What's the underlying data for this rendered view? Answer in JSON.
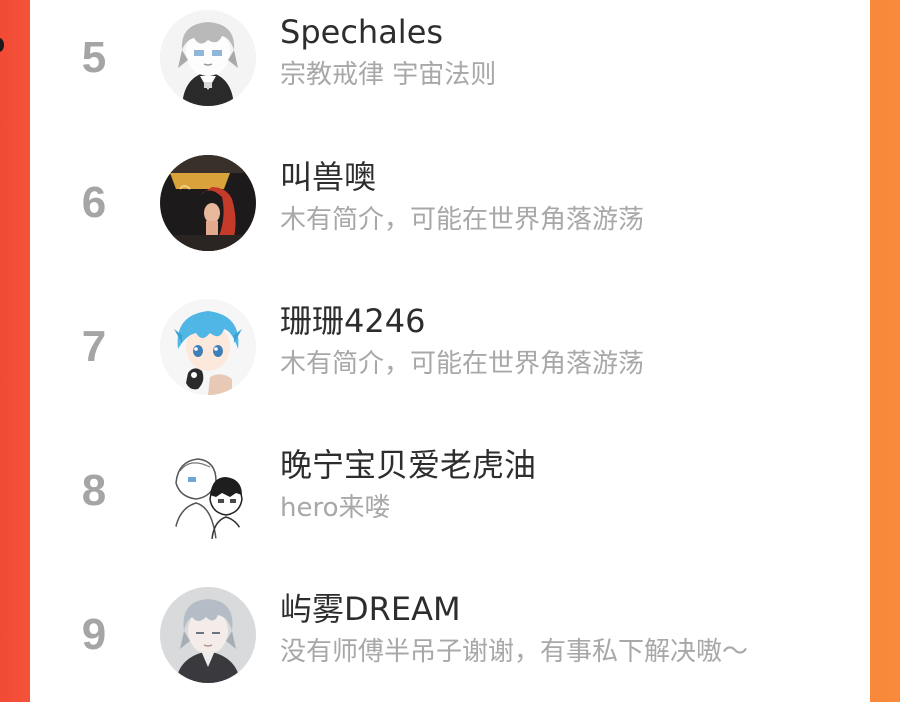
{
  "ranking": {
    "items": [
      {
        "rank": "5",
        "name": "Spechales",
        "bio": "宗教戒律 宇宙法则",
        "avatar_icon": "anime-gray-hair-avatar-icon"
      },
      {
        "rank": "6",
        "name": "叫兽噢",
        "bio": "木有简介，可能在世界角落游荡",
        "avatar_icon": "mermaid-poster-avatar-icon"
      },
      {
        "rank": "7",
        "name": "珊珊4246",
        "bio": "木有简介，可能在世界角落游荡",
        "avatar_icon": "anime-blue-hair-avatar-icon"
      },
      {
        "rank": "8",
        "name": "晚宁宝贝爱老虎油",
        "bio": "hero来喽",
        "avatar_icon": "sketch-couple-avatar-icon"
      },
      {
        "rank": "9",
        "name": "屿雾DREAM",
        "bio": "没有师傅半吊子谢谢，有事私下解决嗷～",
        "avatar_icon": "anime-silver-hair-avatar-icon"
      }
    ]
  },
  "colors": {
    "background_left": "#f24a35",
    "background_right": "#f88a3a",
    "panel": "#ffffff",
    "rank_number": "#a5a5a5",
    "name_text": "#2d2d2d",
    "bio_text": "#a8a8a8"
  }
}
